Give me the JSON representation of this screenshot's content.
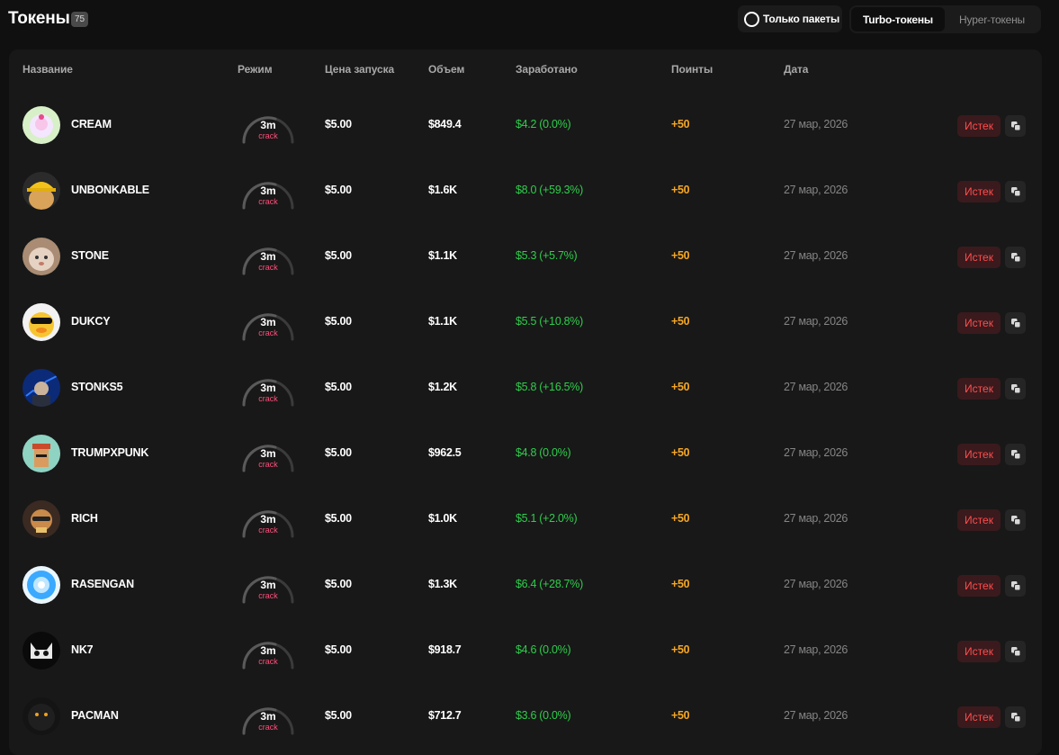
{
  "header": {
    "title": "Токены",
    "count": "75",
    "only_packets_label": "Только пакеты",
    "tabs": [
      {
        "label": "Turbo-токены",
        "active": true
      },
      {
        "label": "Hyper-токены",
        "active": false
      }
    ]
  },
  "columns": {
    "name": "Название",
    "mode": "Режим",
    "launch_price": "Цена запуска",
    "volume": "Объем",
    "earned": "Заработано",
    "points": "Поинты",
    "date": "Дата"
  },
  "colors": {
    "background": "#101010",
    "table_bg": "#181818",
    "earned_green": "#2fcd4c",
    "points_orange": "#f5a623",
    "expired_red": "#ff4d4d",
    "mode_pink": "#ff4f7b"
  },
  "rows": [
    {
      "name": "CREAM",
      "avatar": "cream-avatar-icon",
      "mode_time": "3m",
      "mode_label": "crack",
      "price": "$5.00",
      "volume": "$849.4",
      "earned": "$4.2 (0.0%)",
      "points": "+50",
      "date": "27 мар, 2026",
      "status": "Истек"
    },
    {
      "name": "UNBONKABLE",
      "avatar": "unbonkable-avatar-icon",
      "mode_time": "3m",
      "mode_label": "crack",
      "price": "$5.00",
      "volume": "$1.6K",
      "earned": "$8.0 (+59.3%)",
      "points": "+50",
      "date": "27 мар, 2026",
      "status": "Истек"
    },
    {
      "name": "STONE",
      "avatar": "stone-avatar-icon",
      "mode_time": "3m",
      "mode_label": "crack",
      "price": "$5.00",
      "volume": "$1.1K",
      "earned": "$5.3 (+5.7%)",
      "points": "+50",
      "date": "27 мар, 2026",
      "status": "Истек"
    },
    {
      "name": "DUKCY",
      "avatar": "dukcy-avatar-icon",
      "mode_time": "3m",
      "mode_label": "crack",
      "price": "$5.00",
      "volume": "$1.1K",
      "earned": "$5.5 (+10.8%)",
      "points": "+50",
      "date": "27 мар, 2026",
      "status": "Истек"
    },
    {
      "name": "STONKS5",
      "avatar": "stonks5-avatar-icon",
      "mode_time": "3m",
      "mode_label": "crack",
      "price": "$5.00",
      "volume": "$1.2K",
      "earned": "$5.8 (+16.5%)",
      "points": "+50",
      "date": "27 мар, 2026",
      "status": "Истек"
    },
    {
      "name": "TRUMPXPUNK",
      "avatar": "trumpxpunk-avatar-icon",
      "mode_time": "3m",
      "mode_label": "crack",
      "price": "$5.00",
      "volume": "$962.5",
      "earned": "$4.8 (0.0%)",
      "points": "+50",
      "date": "27 мар, 2026",
      "status": "Истек"
    },
    {
      "name": "RICH",
      "avatar": "rich-avatar-icon",
      "mode_time": "3m",
      "mode_label": "crack",
      "price": "$5.00",
      "volume": "$1.0K",
      "earned": "$5.1 (+2.0%)",
      "points": "+50",
      "date": "27 мар, 2026",
      "status": "Истек"
    },
    {
      "name": "RASENGAN",
      "avatar": "rasengan-avatar-icon",
      "mode_time": "3m",
      "mode_label": "crack",
      "price": "$5.00",
      "volume": "$1.3K",
      "earned": "$6.4 (+28.7%)",
      "points": "+50",
      "date": "27 мар, 2026",
      "status": "Истек"
    },
    {
      "name": "NK7",
      "avatar": "nk7-avatar-icon",
      "mode_time": "3m",
      "mode_label": "crack",
      "price": "$5.00",
      "volume": "$918.7",
      "earned": "$4.6 (0.0%)",
      "points": "+50",
      "date": "27 мар, 2026",
      "status": "Истек"
    },
    {
      "name": "PACMAN",
      "avatar": "pacman-avatar-icon",
      "mode_time": "3m",
      "mode_label": "crack",
      "price": "$5.00",
      "volume": "$712.7",
      "earned": "$3.6 (0.0%)",
      "points": "+50",
      "date": "27 мар, 2026",
      "status": "Истек"
    }
  ]
}
